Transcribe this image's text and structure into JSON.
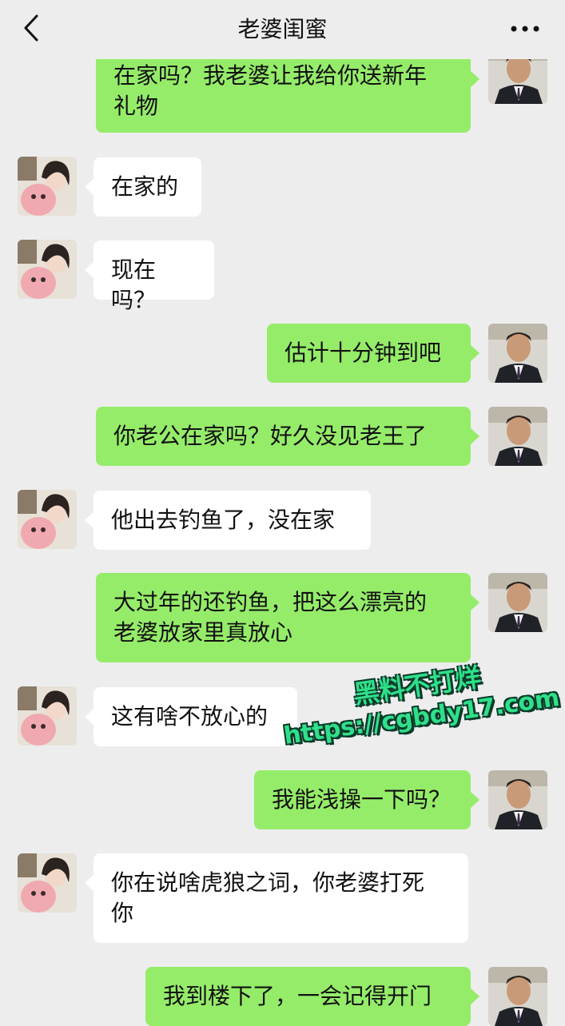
{
  "header": {
    "title": "老婆闺蜜",
    "back_icon": "chevron-left-icon",
    "more_icon": "more-dots-icon"
  },
  "colors": {
    "background": "#ededed",
    "sent_bubble": "#95ec69",
    "received_bubble": "#ffffff",
    "watermark": "#2fe08a"
  },
  "messages": [
    {
      "side": "right",
      "text": "在家吗？我老婆让我给你送新年礼物",
      "lines": [
        "在家吗？我老婆让我给你送新年",
        "礼物"
      ]
    },
    {
      "side": "left",
      "text": "在家的",
      "lines": [
        "在家的"
      ]
    },
    {
      "side": "left",
      "text": "现在吗？",
      "lines": [
        "现在吗？"
      ]
    },
    {
      "side": "right",
      "text": "估计十分钟到吧",
      "lines": [
        "估计十分钟到吧"
      ]
    },
    {
      "side": "right",
      "text": "你老公在家吗？好久没见老王了",
      "lines": [
        "你老公在家吗？好久没见老王了"
      ]
    },
    {
      "side": "left",
      "text": "他出去钓鱼了，没在家",
      "lines": [
        "他出去钓鱼了，没在家"
      ]
    },
    {
      "side": "right",
      "text": "大过年的还钓鱼，把这么漂亮的老婆放家里真放心",
      "lines": [
        "大过年的还钓鱼，把这么漂亮的",
        "老婆放家里真放心"
      ]
    },
    {
      "side": "left",
      "text": "这有啥不放心的",
      "lines": [
        "这有啥不放心的"
      ]
    },
    {
      "side": "right",
      "text": "我能浅操一下吗？",
      "lines": [
        "我能浅操一下吗？"
      ]
    },
    {
      "side": "left",
      "text": "你在说啥虎狼之词，你老婆打死你",
      "lines": [
        "你在说啥虎狼之词，你老婆打死",
        "你"
      ]
    },
    {
      "side": "right",
      "text": "我到楼下了，一会记得开门",
      "lines": [
        "我到楼下了，一会记得开门"
      ]
    }
  ],
  "watermark": {
    "line1": "黑料不打烊",
    "line2": "https://cgbdy17.com"
  }
}
